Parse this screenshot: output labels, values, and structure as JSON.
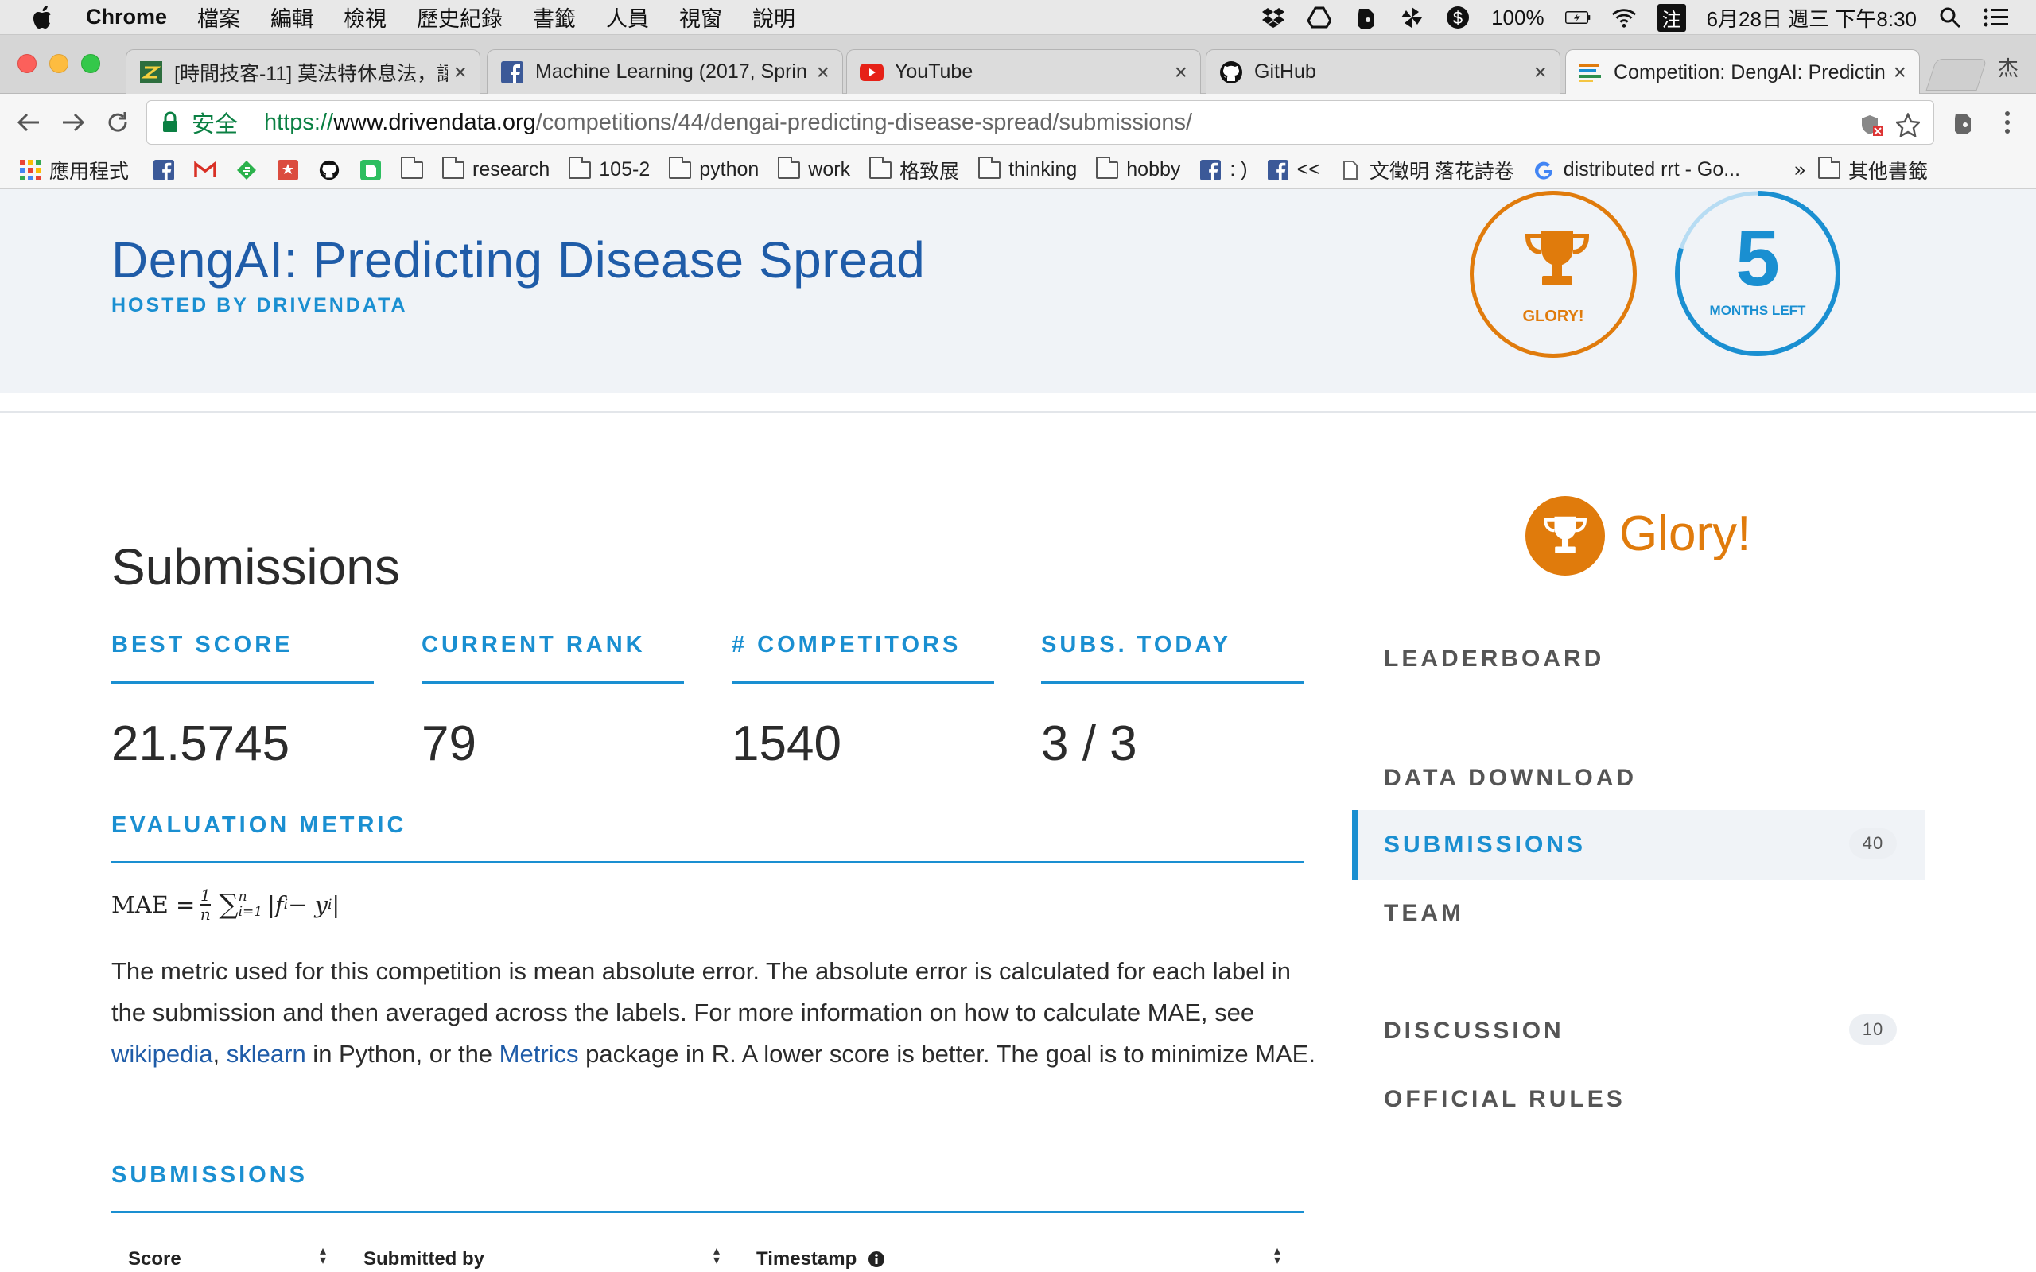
{
  "menubar": {
    "app": "Chrome",
    "items": [
      "檔案",
      "編輯",
      "檢視",
      "歷史紀錄",
      "書籤",
      "人員",
      "視窗",
      "說明"
    ],
    "battery": "100%",
    "input_method": "注",
    "clock": "6月28日 週三 下午8:30"
  },
  "tabs": [
    {
      "title": "[時間技客-11] 莫法特休息法，讓",
      "close": "×"
    },
    {
      "title": "Machine Learning (2017, Sprin",
      "close": "×"
    },
    {
      "title": "YouTube",
      "close": "×"
    },
    {
      "title": "GitHub",
      "close": "×"
    },
    {
      "title": "Competition: DengAI: Predictin",
      "close": "×"
    }
  ],
  "profile": "杰",
  "omnibox": {
    "secure_label": "安全",
    "url_proto": "https://",
    "url_host": "www.drivendata.org",
    "url_path": "/competitions/44/dengai-predicting-disease-spread/submissions/"
  },
  "bookmarks": {
    "apps": "應用程式",
    "research": "research",
    "f1052": "105-2",
    "python": "python",
    "work": "work",
    "gezhi": "格致展",
    "thinking": "thinking",
    "hobby": "hobby",
    "fb_smile": ": )",
    "fb_back": "<<",
    "doc": "文徵明 落花詩卷",
    "google": "distributed rrt - Go...",
    "more": "»",
    "other": "其他書籤"
  },
  "hero": {
    "title": "DengAI: Predicting Disease Spread",
    "hosted_by": "HOSTED BY DRIVENDATA",
    "glory_badge": "GLORY!",
    "months_left_num": "5",
    "months_left_label": "MONTHS LEFT",
    "months_left_fraction": 0.8
  },
  "main": {
    "title": "Submissions",
    "stats": [
      {
        "label": "BEST SCORE",
        "value": "21.5745"
      },
      {
        "label": "CURRENT RANK",
        "value": "79"
      },
      {
        "label": "# COMPETITORS",
        "value": "1540"
      },
      {
        "label": "SUBS. TODAY",
        "value": "3 / 3"
      }
    ],
    "eval_heading": "EVALUATION METRIC",
    "formula": {
      "lhs": "MAE =",
      "num": "1",
      "den": "n",
      "upper": "n",
      "lower": "i=1",
      "body": "|f",
      "sub_i": "i",
      "minus": " − y",
      "close": "|"
    },
    "desc_1": "The metric used for this competition is mean absolute error. The absolute error is calculated for each label in the submission and then averaged across the labels. For more information on how to calculate MAE, see ",
    "link_wikipedia": "wikipedia",
    "comma": ", ",
    "link_sklearn": "sklearn",
    "desc_2": " in Python, or the ",
    "link_metrics": "Metrics",
    "desc_3": " package in R. A lower score is better. The goal is to minimize MAE.",
    "subs_heading": "SUBMISSIONS",
    "table_headers": [
      "Score",
      "Submitted by",
      "Timestamp"
    ]
  },
  "sidebar": {
    "glory": "Glory!",
    "items": [
      {
        "label": "LEADERBOARD"
      },
      {
        "label": "DATA DOWNLOAD"
      },
      {
        "label": "SUBMISSIONS",
        "count": "40"
      },
      {
        "label": "TEAM"
      },
      {
        "label": "DISCUSSION",
        "count": "10"
      },
      {
        "label": "OFFICIAL RULES"
      }
    ]
  },
  "colors": {
    "brand_blue": "#1a8fd1",
    "title_blue": "#1f5ca8",
    "glory_orange": "#e07b0c",
    "secure_green": "#0b8043"
  }
}
